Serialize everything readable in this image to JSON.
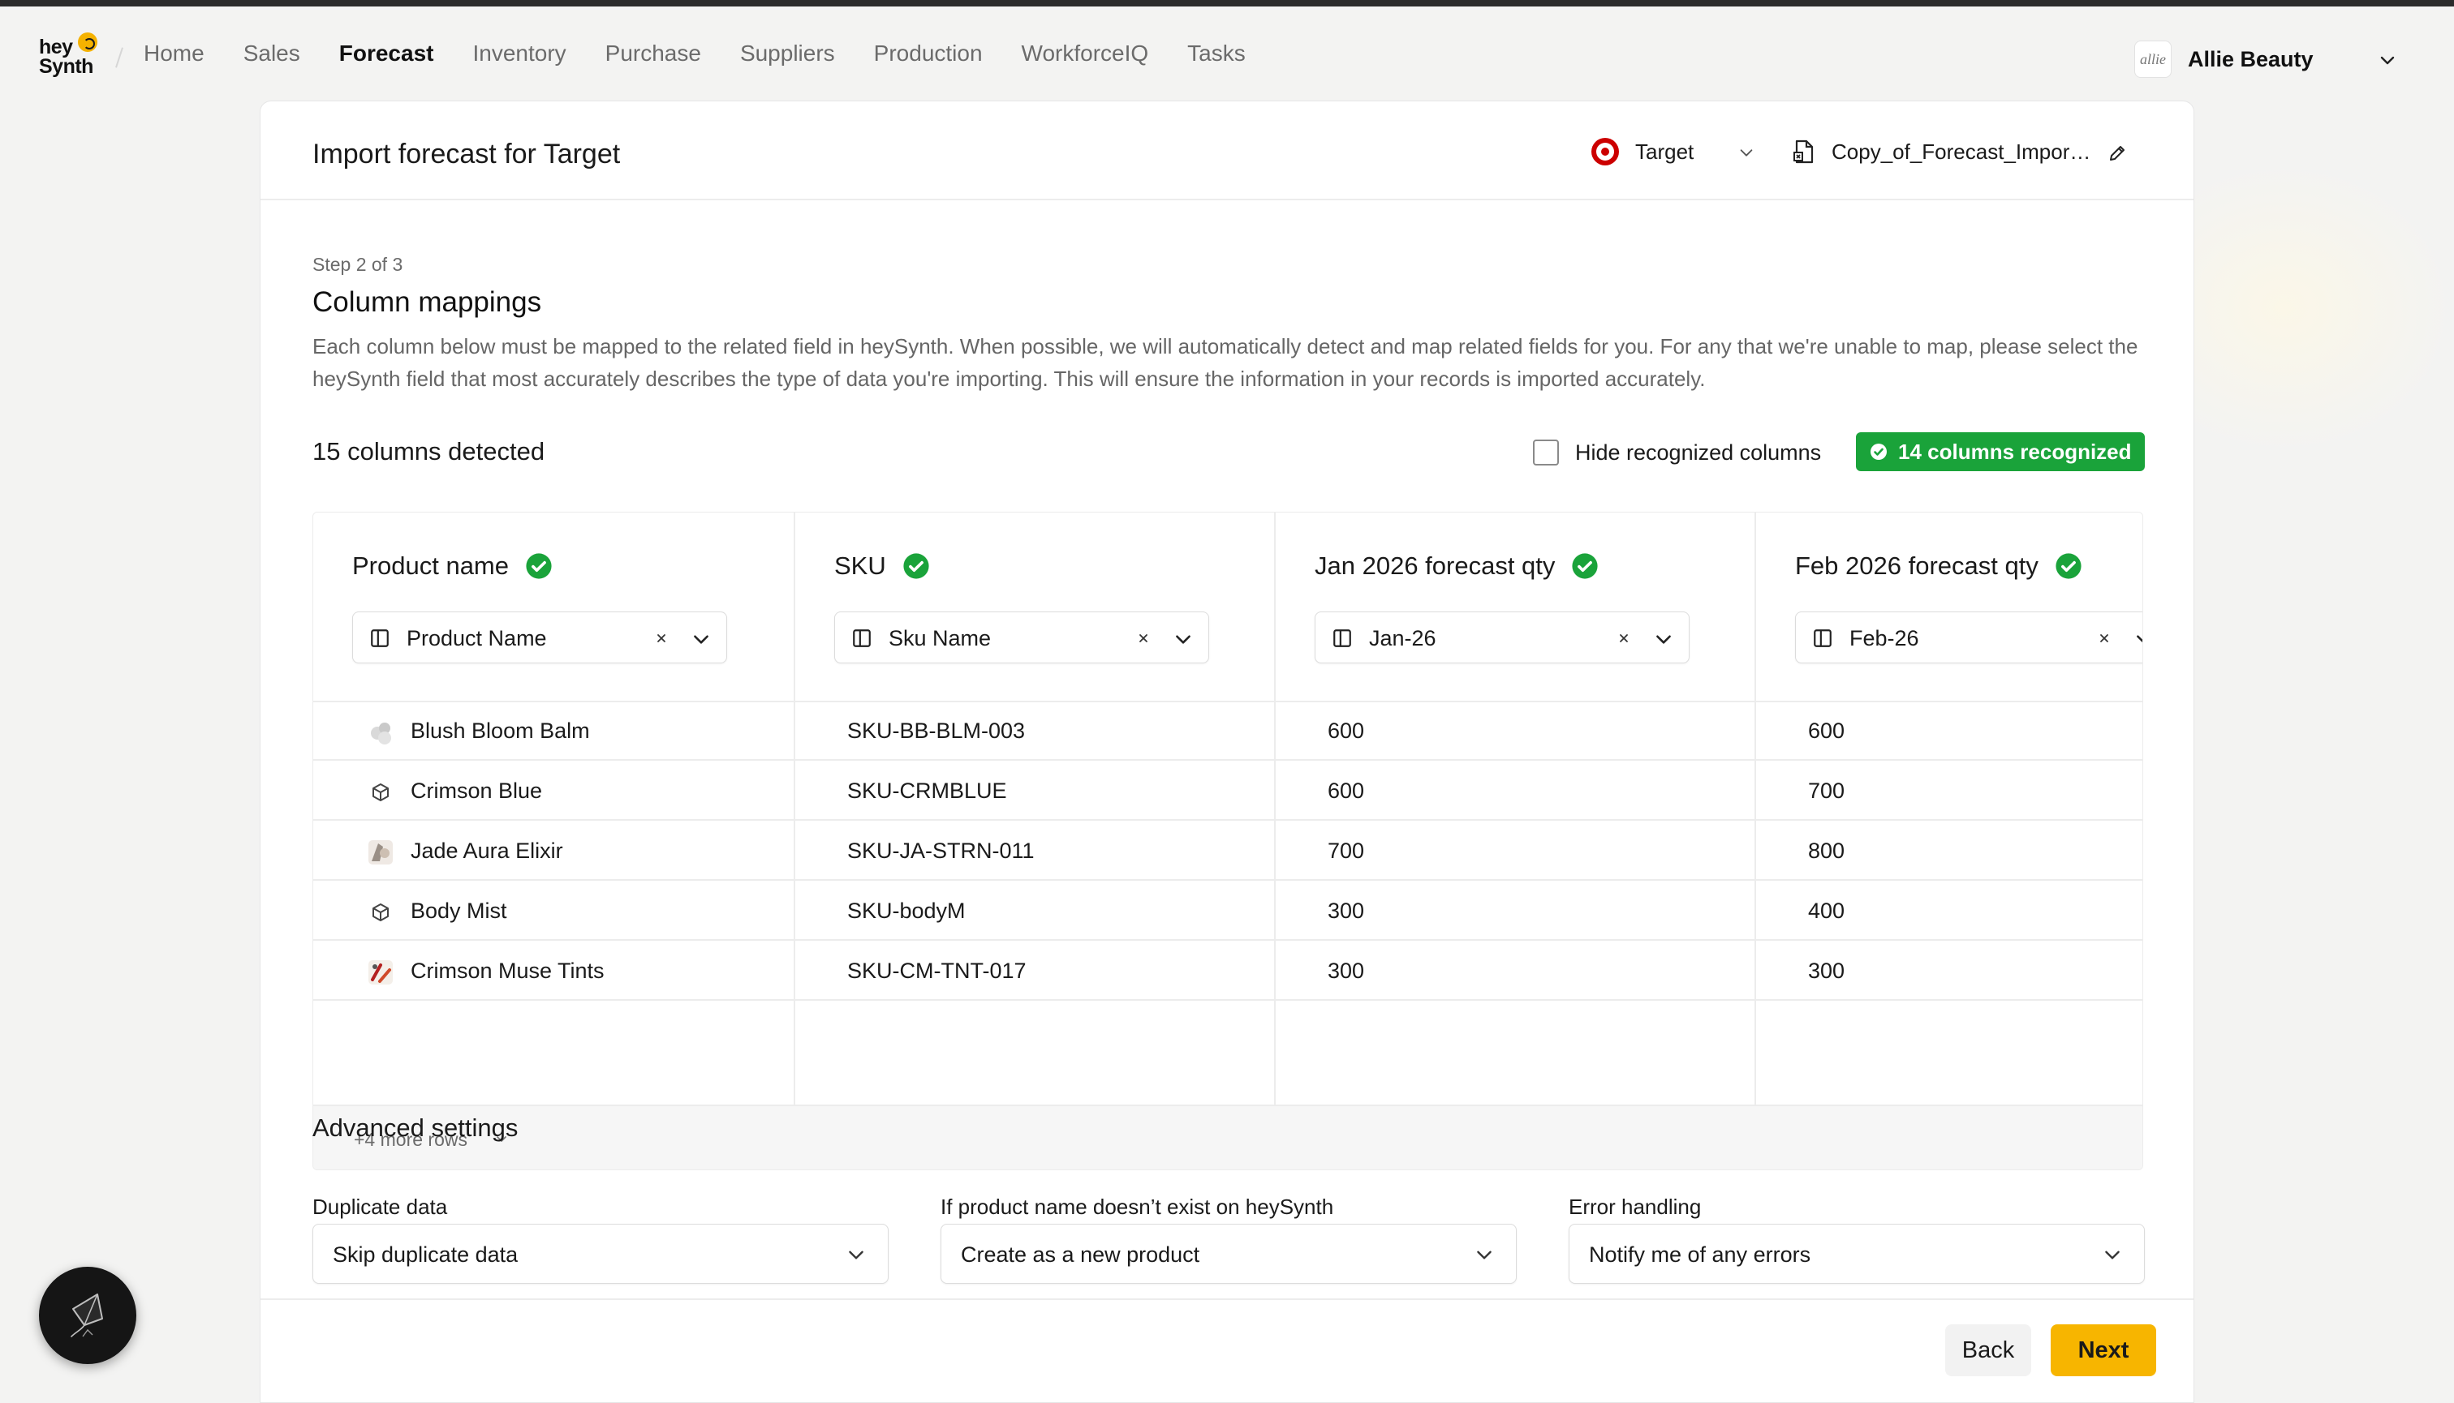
{
  "nav": {
    "logo": {
      "line1": "hey",
      "line2": "Synth"
    },
    "links": [
      "Home",
      "Sales",
      "Forecast",
      "Inventory",
      "Purchase",
      "Suppliers",
      "Production",
      "WorkforceIQ",
      "Tasks"
    ],
    "active": "Forecast",
    "account": {
      "logo_text": "allie",
      "name": "Allie Beauty"
    }
  },
  "header": {
    "title": "Import forecast for Target",
    "retailer": "Target",
    "file_name": "Copy_of_Forecast_Impor…"
  },
  "step": "Step 2 of 3",
  "section": {
    "title": "Column mappings",
    "description": "Each column below must be mapped to the related field in heySynth. When possible, we will automatically detect and map related fields for you. For any that we're unable to map, please select the heySynth field that most accurately describes the type of data you're importing. This will ensure the information in your records is imported accurately."
  },
  "summary": {
    "detected": "15 columns detected",
    "hide_label": "Hide recognized columns",
    "recognized": "14 columns recognized"
  },
  "columns": [
    {
      "title": "Product name",
      "mapped": "Product Name",
      "rows": [
        "Blush Bloom Balm",
        "Crimson Blue",
        "Jade Aura Elixir",
        "Body Mist",
        "Crimson Muse Tints"
      ]
    },
    {
      "title": "SKU",
      "mapped": "Sku Name",
      "rows": [
        "SKU-BB-BLM-003",
        "SKU-CRMBLUE",
        "SKU-JA-STRN-011",
        "SKU-bodyM",
        "SKU-CM-TNT-017"
      ]
    },
    {
      "title": "Jan 2026 forecast qty",
      "mapped": "Jan-26",
      "rows": [
        "600",
        "600",
        "700",
        "300",
        "300"
      ]
    },
    {
      "title": "Feb 2026 forecast qty",
      "mapped": "Feb-26",
      "rows": [
        "600",
        "700",
        "800",
        "400",
        "300"
      ]
    }
  ],
  "more_rows": "+4 more rows",
  "advanced": {
    "title": "Advanced settings",
    "fields": [
      {
        "label": "Duplicate data",
        "value": "Skip duplicate data"
      },
      {
        "label": "If product name doesn’t exist on heySynth",
        "value": "Create as a new product"
      },
      {
        "label": "Error handling",
        "value": "Notify me of any errors"
      }
    ]
  },
  "footer": {
    "back": "Back",
    "next": "Next"
  },
  "colors": {
    "accent": "#f7b500",
    "success": "#1aa33a",
    "brand_target": "#cc0000"
  }
}
